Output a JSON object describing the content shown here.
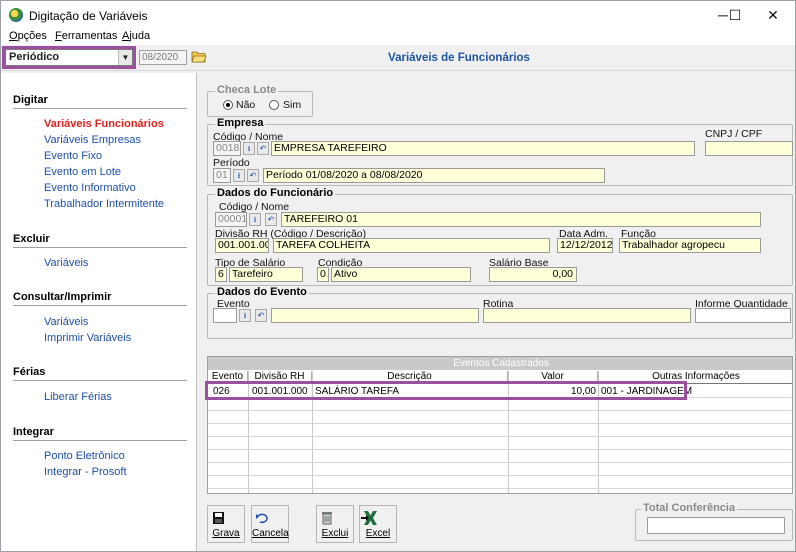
{
  "window": {
    "title": "Digitação de Variáveis",
    "controls": [
      "─",
      "☐",
      "✕"
    ]
  },
  "menu": [
    {
      "first": "O",
      "rest": "pções"
    },
    {
      "first": "F",
      "rest": "erramentas"
    },
    {
      "first": "A",
      "rest": "juda"
    }
  ],
  "toolbar": {
    "period_combo": "Periódico",
    "date": "08/2020",
    "main_title": "Variáveis de Funcionários"
  },
  "sidebar": {
    "sections": [
      {
        "title": "Digitar",
        "items": [
          "Variáveis Funcionários",
          "Variáveis Empresas",
          "Evento Fixo",
          "Evento em Lote",
          "Evento Informativo",
          "Trabalhador Intermitente"
        ]
      },
      {
        "title": "Excluir",
        "items": [
          "Variáveis"
        ]
      },
      {
        "title": "Consultar/Imprimir",
        "items": [
          "Variáveis",
          "Imprimir Variáveis"
        ]
      },
      {
        "title": "Férias",
        "items": [
          "Liberar Férias"
        ]
      },
      {
        "title": "Integrar",
        "items": [
          "Ponto Eletrônico",
          "Integrar - Prosoft"
        ]
      }
    ]
  },
  "checa_lote": {
    "title": "Checa Lote",
    "opt_no": "Não",
    "opt_yes": "Sim"
  },
  "empresa": {
    "title": "Empresa",
    "codigo_label": "Código / Nome",
    "codigo": "0018",
    "nome": "EMPRESA TAREFEIRO",
    "cnpj_label": "CNPJ / CPF",
    "periodo_label": "Período",
    "periodo_code": "01",
    "periodo": "Período 01/08/2020 a 08/08/2020"
  },
  "funcionario": {
    "title": "Dados do Funcionário",
    "codigo_label": "Código / Nome",
    "codigo": "00001",
    "nome": "TAREFEIRO 01",
    "divisao_label": "Divisão RH (Código / Descrição)",
    "divisao_code": "001.001.000",
    "divisao_desc": "TAREFA COLHEITA",
    "data_adm_label": "Data Adm.",
    "data_adm": "12/12/2012",
    "funcao_label": "Função",
    "funcao": "Trabalhador agropecu",
    "tipo_salario_label": "Tipo de Salário",
    "tipo_salario_code": "6",
    "tipo_salario": "Tarefeiro",
    "condicao_label": "Condição",
    "condicao_code": "0",
    "condicao": "Ativo",
    "salario_base_label": "Salário Base",
    "salario_base": "0,00"
  },
  "evento": {
    "title": "Dados do Evento",
    "evento_label": "Evento",
    "rotina_label": "Rotina",
    "informe_label": "Informe Quantidade"
  },
  "grid": {
    "caption": "Eventos Cadastrados",
    "columns": [
      "Evento",
      "Divisão RH",
      "Descrição",
      "Valor",
      "Outras Informações"
    ],
    "rows": [
      [
        "026",
        "001.001.000",
        "SALÁRIO TAREFA",
        "10,00",
        "001 - JARDINAGEM"
      ]
    ]
  },
  "buttons": {
    "grava": "Grava",
    "cancela": "Cancela",
    "exclui": "Exclui",
    "excel": "Excel"
  },
  "total": {
    "title": "Total Conferência"
  },
  "colors": {
    "accent_blue": "#1e56a0",
    "active_red": "#e02020",
    "highlight": "#9b4f9e"
  }
}
